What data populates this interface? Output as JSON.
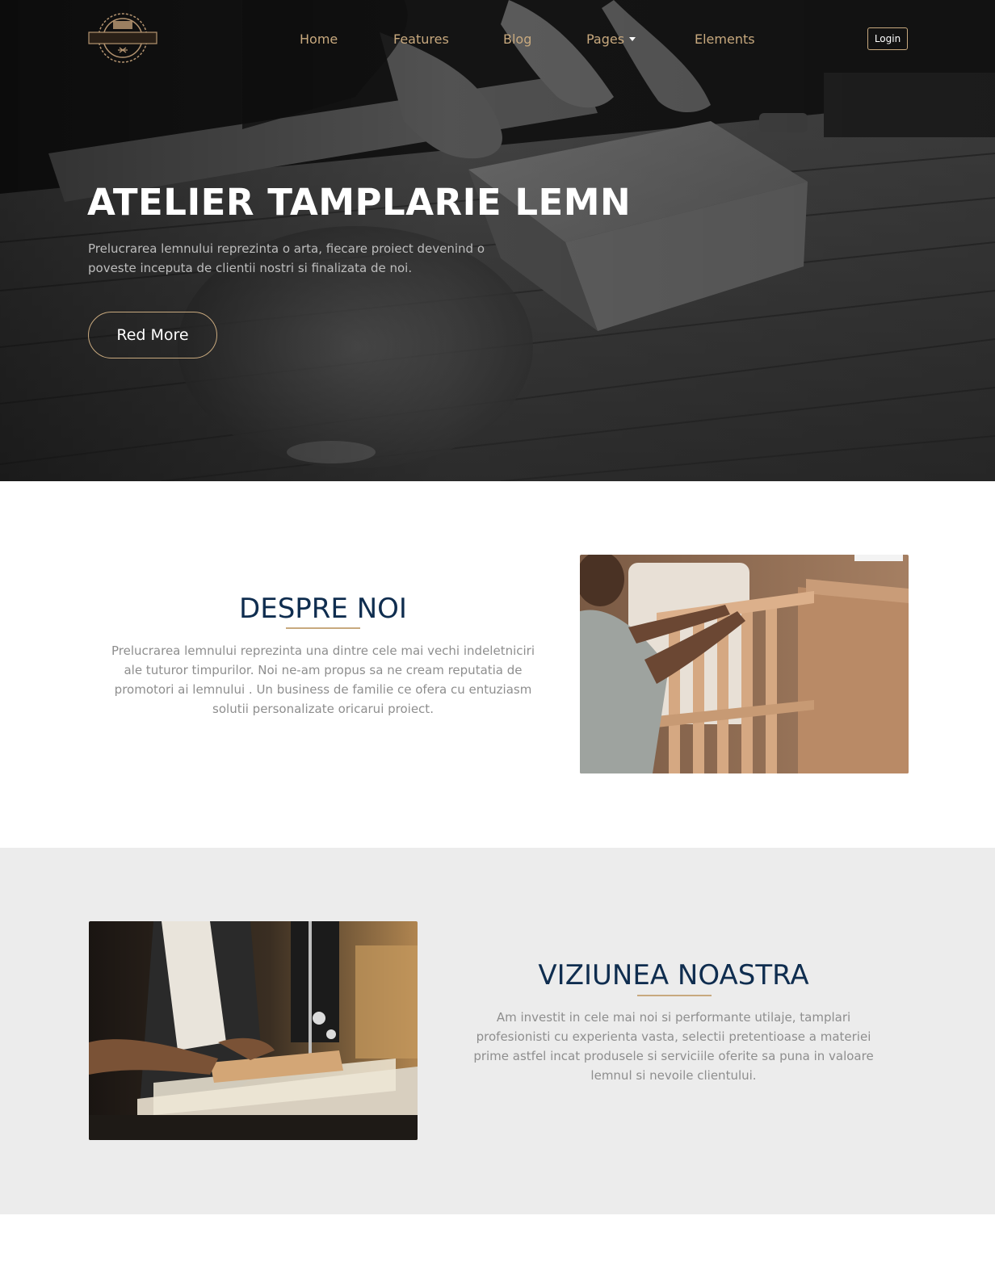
{
  "header": {
    "logo_alt": "WOOD WORKING",
    "nav": [
      {
        "label": "Home"
      },
      {
        "label": "Features"
      },
      {
        "label": "Blog"
      },
      {
        "label": "Pages",
        "has_dropdown": true
      },
      {
        "label": "Elements"
      }
    ],
    "login_label": "Login"
  },
  "hero": {
    "title": "ATELIER TAMPLARIE LEMN",
    "text": "Prelucrarea lemnului reprezinta o arta, fiecare proiect devenind o poveste inceputa de clientii nostri si finalizata de noi.",
    "button_label": "Red More"
  },
  "about": {
    "title": "DESPRE NOI",
    "text": "Prelucrarea lemnului reprezinta una dintre cele mai vechi indeletniciri ale tuturor timpurilor. Noi ne-am propus sa ne cream reputatia de promotori ai lemnului . Un business de familie ce ofera cu entuziasm solutii personalizate oricarui proiect."
  },
  "vision": {
    "title": "VIZIUNEA NOASTRA",
    "text": "Am investit in cele mai noi si performante utilaje, tamplari profesionisti cu experienta vasta, selectii pretentioase a materiei prime astfel incat produsele si serviciile oferite sa puna in valoare lemnul si nevoile clientului."
  },
  "colors": {
    "accent_gold": "#c8a97e",
    "heading_navy": "#0f2d4f",
    "body_gray": "#8e8e8e",
    "section_gray": "#ececec"
  },
  "icons": [
    "logo-badge-icon",
    "chevron-down-icon"
  ]
}
